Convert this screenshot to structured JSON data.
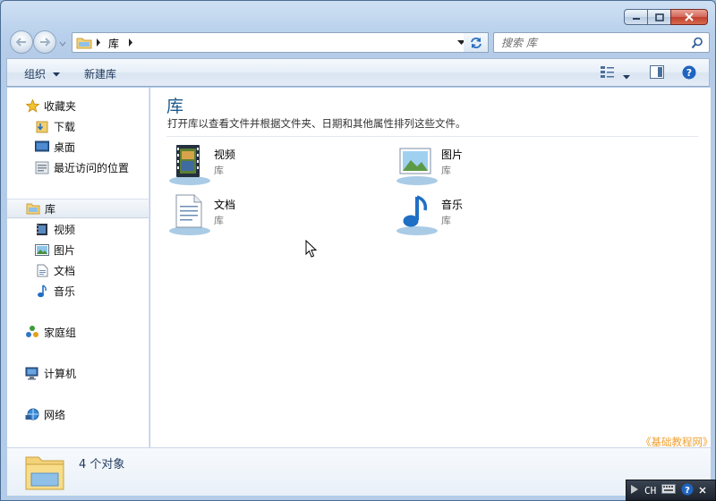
{
  "address_bar": {
    "crumbs": [
      "库"
    ]
  },
  "search": {
    "placeholder": "搜索 库"
  },
  "command_bar": {
    "organize": "组织",
    "new_library": "新建库"
  },
  "nav_pane": {
    "favorites": {
      "label": "收藏夹",
      "items": [
        "下载",
        "桌面",
        "最近访问的位置"
      ]
    },
    "libraries": {
      "label": "库",
      "items": [
        "视频",
        "图片",
        "文档",
        "音乐"
      ]
    },
    "homegroup": "家庭组",
    "computer": "计算机",
    "network": "网络"
  },
  "content": {
    "title": "库",
    "subtitle": "打开库以查看文件并根据文件夹、日期和其他属性排列这些文件。",
    "libraries": [
      {
        "name": "视频",
        "kind": "库",
        "icon": "video-library-icon"
      },
      {
        "name": "图片",
        "kind": "库",
        "icon": "pictures-library-icon"
      },
      {
        "name": "文档",
        "kind": "库",
        "icon": "documents-library-icon"
      },
      {
        "name": "音乐",
        "kind": "库",
        "icon": "music-library-icon"
      }
    ]
  },
  "details_pane": {
    "count_text": "4 个对象"
  },
  "watermark": "《基础教程网》",
  "tray": {
    "language": "CH"
  },
  "colors": {
    "accent_title": "#1e5a8c",
    "selected_bg": "#e4ebf3",
    "frame": "#b4cce8"
  }
}
